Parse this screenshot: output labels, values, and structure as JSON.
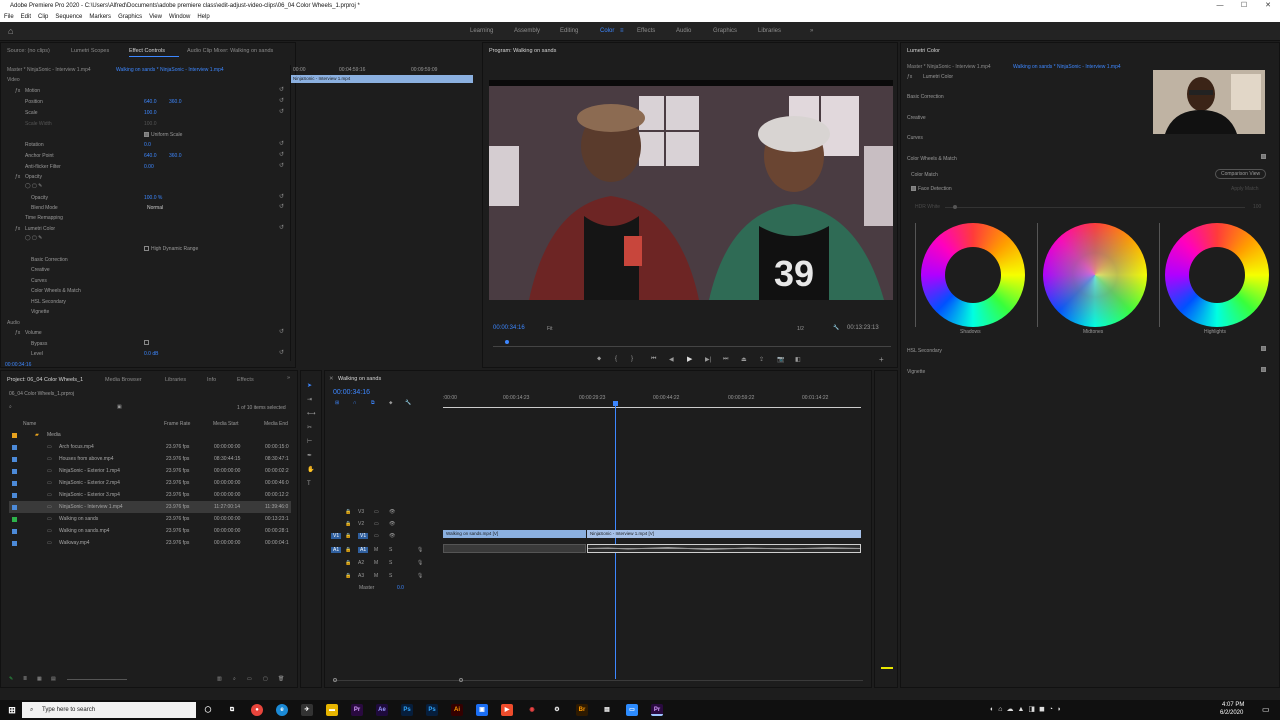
{
  "window": {
    "title": "Adobe Premiere Pro 2020 - C:\\Users\\Alfred\\Documents\\adobe premiere class\\edit-adjust-video-clips\\06_04 Color Wheels_1.prproj *"
  },
  "menu": [
    "File",
    "Edit",
    "Clip",
    "Sequence",
    "Markers",
    "Graphics",
    "View",
    "Window",
    "Help"
  ],
  "workspaces": [
    "Learning",
    "Assembly",
    "Editing",
    "Color",
    "Effects",
    "Audio",
    "Graphics",
    "Libraries"
  ],
  "active_workspace": "Color",
  "effect_controls": {
    "tabs": [
      "Source: (no clips)",
      "Lumetri Scopes",
      "Effect Controls",
      "Audio Clip Mixer: Walking on sands"
    ],
    "active_tab": "Effect Controls",
    "master_label": "Master * NinjaSonic - Interview 1.mp4",
    "clip_label": "Walking on sands * NinjaSonic - Interview 1.mp4",
    "ruler": [
      "00:00",
      "00:04:59:16",
      "00:09:59:09"
    ],
    "clip_in_timeline": "NinjaSonic - Interview 1.mp4",
    "video_header": "Video",
    "motion": "Motion",
    "position": {
      "label": "Position",
      "x": "640.0",
      "y": "360.0"
    },
    "scale": {
      "label": "Scale",
      "value": "100.0"
    },
    "scale_width": {
      "label": "Scale Width",
      "value": "100.0"
    },
    "uniform_scale": "Uniform Scale",
    "rotation": {
      "label": "Rotation",
      "value": "0.0"
    },
    "anchor": {
      "label": "Anchor Point",
      "x": "640.0",
      "y": "360.0"
    },
    "anti_flicker": {
      "label": "Anti-flicker Filter",
      "value": "0.00"
    },
    "opacity_header": "Opacity",
    "opacity": {
      "label": "Opacity",
      "value": "100.0 %"
    },
    "blend_mode": {
      "label": "Blend Mode",
      "value": "Normal"
    },
    "time_remapping": "Time Remapping",
    "lumetri": "Lumetri Color",
    "hdr": "High Dynamic Range",
    "lumetri_sections": [
      "Basic Correction",
      "Creative",
      "Curves",
      "Color Wheels & Match",
      "HSL Secondary",
      "Vignette"
    ],
    "audio_header": "Audio",
    "volume": "Volume",
    "bypass": "Bypass",
    "level": {
      "label": "Level",
      "value": "0.0 dB"
    },
    "timecode": "00:00:34:16"
  },
  "program": {
    "tab": "Program: Walking on sands",
    "timecode": "00:00:34:16",
    "fit": "Fit",
    "resolution": "1/2",
    "duration": "00:13:23:13"
  },
  "lumetri_panel": {
    "tab": "Lumetri Color",
    "master_label": "Master * NinjaSonic - Interview 1.mp4",
    "clip_label": "Walking on sands * NinjaSonic - Interview 1.mp4",
    "effect_name": "Lumetri Color",
    "sections": [
      "Basic Correction",
      "Creative",
      "Curves",
      "Color Wheels & Match"
    ],
    "color_match": "Color Match",
    "comparison_view": "Comparison View",
    "face_detection": "Face Detection",
    "apply_match": "Apply Match",
    "hdr_white": "HDR White",
    "hdr_value": "100",
    "wheels": [
      "Shadows",
      "Midtones",
      "Highlights"
    ],
    "hsl": "HSL Secondary",
    "vignette": "Vignette"
  },
  "project": {
    "tabs": [
      "Project: 06_04 Color Wheels_1",
      "Media Browser",
      "Libraries",
      "Info",
      "Effects"
    ],
    "file": "06_04 Color Wheels_1.prproj",
    "selection_info": "1 of 10 items selected",
    "columns": [
      "Name",
      "Frame Rate",
      "Media Start",
      "Media End"
    ],
    "items": [
      {
        "name": "Media",
        "rate": "",
        "start": "",
        "end": "",
        "color": "#e7a21e",
        "selected": false
      },
      {
        "name": "Arch focus.mp4",
        "rate": "23.976 fps",
        "start": "00:00:00:00",
        "end": "00:00:15:0",
        "color": "#4c8ad8",
        "selected": false
      },
      {
        "name": "Houses from above.mp4",
        "rate": "23.976 fps",
        "start": "08:30:44:15",
        "end": "08:30:47:1",
        "color": "#4c8ad8",
        "selected": false
      },
      {
        "name": "NinjaSonic - Exterior 1.mp4",
        "rate": "23.976 fps",
        "start": "00:00:00:00",
        "end": "00:00:02:2",
        "color": "#4c8ad8",
        "selected": false
      },
      {
        "name": "NinjaSonic - Exterior 2.mp4",
        "rate": "23.976 fps",
        "start": "00:00:00:00",
        "end": "00:00:46:0",
        "color": "#4c8ad8",
        "selected": false
      },
      {
        "name": "NinjaSonic - Exterior 3.mp4",
        "rate": "23.976 fps",
        "start": "00:00:00:00",
        "end": "00:00:12:2",
        "color": "#4c8ad8",
        "selected": false
      },
      {
        "name": "NinjaSonic - Interview 1.mp4",
        "rate": "23.976 fps",
        "start": "11:27:00:14",
        "end": "11:39:46:0",
        "color": "#4c8ad8",
        "selected": true
      },
      {
        "name": "Walking on sands",
        "rate": "23.976 fps",
        "start": "00:00:00:00",
        "end": "00:13:23:1",
        "color": "#2db24a",
        "selected": false
      },
      {
        "name": "Walking on sands.mp4",
        "rate": "23.976 fps",
        "start": "00:00:00:00",
        "end": "00:00:28:1",
        "color": "#4c8ad8",
        "selected": false
      },
      {
        "name": "Walkway.mp4",
        "rate": "23.976 fps",
        "start": "00:00:00:00",
        "end": "00:00:04:1",
        "color": "#4c8ad8",
        "selected": false
      }
    ]
  },
  "timeline": {
    "tab": "Walking on sands",
    "timecode": "00:00:34:16",
    "ruler": [
      ":00:00",
      "00:00:14:23",
      "00:00:29:23",
      "00:00:44:22",
      "00:00:59:22",
      "00:01:14:22"
    ],
    "tracks": [
      "V3",
      "V2",
      "V1",
      "A1",
      "A2",
      "A3"
    ],
    "master": "Master",
    "master_value": "0.0",
    "clip1": "Walking on sands.mp4 [V]",
    "clip2": "NinjaSonic - Interview 1.mp4 [V]"
  },
  "taskbar": {
    "search_placeholder": "Type here to search",
    "time": "4:07 PM",
    "date": "6/2/2020"
  }
}
